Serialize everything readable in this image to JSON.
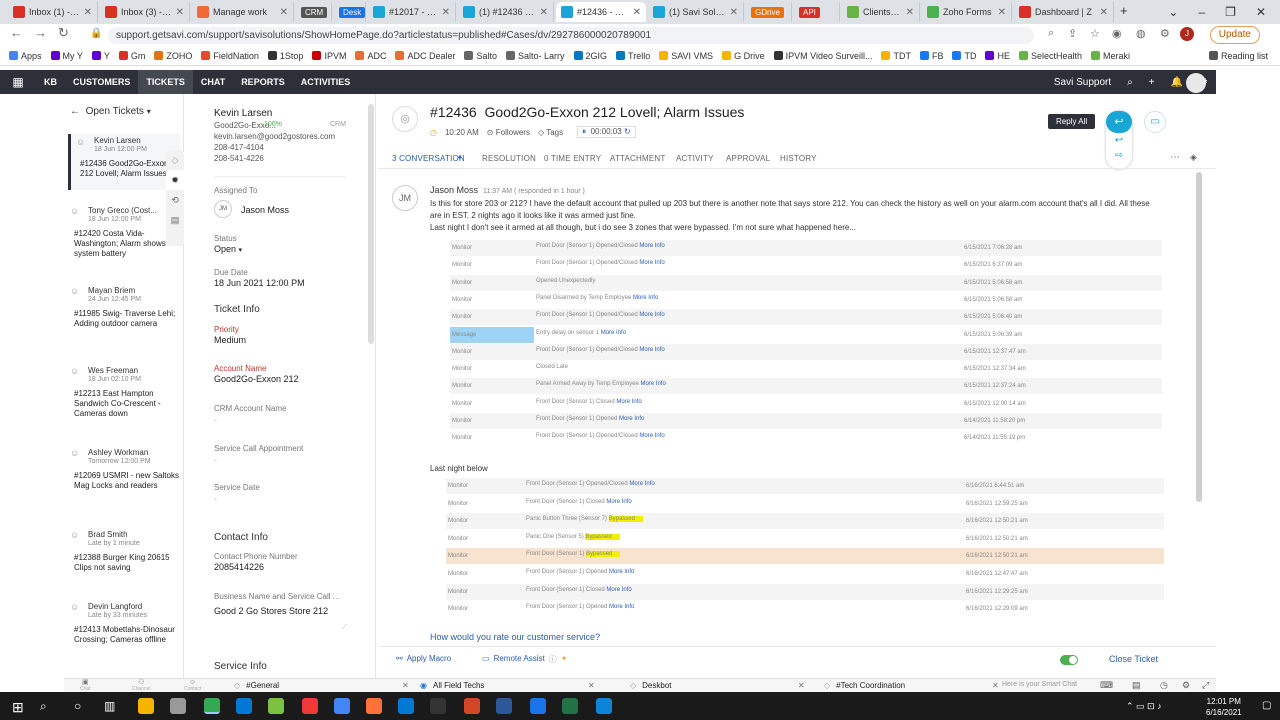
{
  "browser": {
    "tabs": [
      {
        "label": "Inbox (1) - jaso",
        "icon": "gmail-icon",
        "color": "#d93025",
        "chip": ""
      },
      {
        "label": "Inbox (3) - squ",
        "icon": "gmail-icon",
        "color": "#d93025",
        "chip": ""
      },
      {
        "label": "Manage work",
        "icon": "form-icon",
        "color": "#f06a35",
        "chip": ""
      },
      {
        "label": "",
        "icon": "",
        "color": "#555",
        "chip": "CRM"
      },
      {
        "label": "",
        "icon": "",
        "color": "#1a73e8",
        "chip": "Desk"
      },
      {
        "label": "#12017 - Savi",
        "icon": "desk-icon",
        "color": "#19a5d6",
        "chip": ""
      },
      {
        "label": "(1) #12436 - Sa",
        "icon": "desk-icon",
        "color": "#19a5d6",
        "chip": ""
      },
      {
        "label": "#12436 - Savi",
        "icon": "desk-icon",
        "color": "#19a5d6",
        "chip": ""
      },
      {
        "label": "(1) Savi Solutio",
        "icon": "desk-icon",
        "color": "#19a5d6",
        "chip": ""
      },
      {
        "label": "",
        "icon": "",
        "color": "#e8710a",
        "chip": "GDrive"
      },
      {
        "label": "",
        "icon": "",
        "color": "#d93025",
        "chip": "API"
      },
      {
        "label": "Clients - Meraki",
        "icon": "meraki-icon",
        "color": "#67b346",
        "chip": ""
      },
      {
        "label": "Zoho Forms",
        "icon": "form-icon",
        "color": "#4caf50",
        "chip": ""
      },
      {
        "label": "Dashboard | Z",
        "icon": "dashboard-icon",
        "color": "#d93025",
        "chip": ""
      }
    ],
    "url": "support.getsavi.com/support/savisolutions/ShowHomePage.do?articlestatus=published#Cases/dv/292786000020789001",
    "update_label": "Update",
    "bookmarks": [
      {
        "label": "Apps",
        "color": "#4285f4"
      },
      {
        "label": "My Y",
        "color": "#6001d2"
      },
      {
        "label": "Y",
        "color": "#6001d2"
      },
      {
        "label": "Gm",
        "color": "#d93025"
      },
      {
        "label": "ZOHO",
        "color": "#e8710a"
      },
      {
        "label": "FieldNation",
        "color": "#e84a27"
      },
      {
        "label": "1Stop",
        "color": "#333"
      },
      {
        "label": "IPVM",
        "color": "#c00"
      },
      {
        "label": "ADC",
        "color": "#f06a35"
      },
      {
        "label": "ADC Dealer",
        "color": "#f06a35"
      },
      {
        "label": "Salto",
        "color": "#666"
      },
      {
        "label": "Salto- Larry",
        "color": "#666"
      },
      {
        "label": "2GIG",
        "color": "#0077c8"
      },
      {
        "label": "Trello",
        "color": "#0079bf"
      },
      {
        "label": "SAVI VMS",
        "color": "#f4b400"
      },
      {
        "label": "G Drive",
        "color": "#f4b400"
      },
      {
        "label": "IPVM Video Surveill...",
        "color": "#333"
      },
      {
        "label": "TDT",
        "color": "#f4b400"
      },
      {
        "label": "FB",
        "color": "#1877f2"
      },
      {
        "label": "TD",
        "color": "#1877f2"
      },
      {
        "label": "HE",
        "color": "#6001d2"
      },
      {
        "label": "SelectHealth",
        "color": "#67b346"
      },
      {
        "label": "Meraki",
        "color": "#67b346"
      },
      {
        "label": "Reading list",
        "color": "#555"
      }
    ]
  },
  "app_nav": {
    "items": [
      "KB",
      "CUSTOMERS",
      "TICKETS",
      "CHAT",
      "REPORTS",
      "ACTIVITIES"
    ],
    "active": "TICKETS",
    "org": "Savi Support"
  },
  "ticket_list": {
    "header": "Open Tickets",
    "items": [
      {
        "name": "Kevin Larsen",
        "time": "18 Jun 12:00 PM",
        "subject": "#12436 Good2Go-Exxon 212 Lovell; Alarm Issues"
      },
      {
        "name": "Tony Greco (Cost...",
        "time": "18 Jun 12:00 PM",
        "subject": "#12420 Costa Vida-Washington; Alarm shows no system battery"
      },
      {
        "name": "Mayan Briem",
        "time": "24 Jun 12:45 PM",
        "subject": "#11985 Swig- Traverse Lehi; Adding outdoor camera"
      },
      {
        "name": "Wes Freeman",
        "time": "18 Jun 02:10 PM",
        "subject": "#12213 East Hampton Sandwich Co-Crescent - Cameras down"
      },
      {
        "name": "Ashley Workman",
        "time": "Tomorrow 12:00 PM",
        "subject": "#12069 USMRI - new Saltoks Mag Locks and readers"
      },
      {
        "name": "Brad Smith",
        "time": "Late by 1 minute",
        "subject": "#12388 Burger King 20615 Clips not saving"
      },
      {
        "name": "Devin Langford",
        "time": "Late by 33 minutes",
        "subject": "#12413 Mobettahs-Dinosaur Crossing; Cameras offline"
      }
    ]
  },
  "contact": {
    "name": "Kevin Larsen",
    "org": "Good2Go-Exxo...",
    "score": "100%",
    "crm": "CRM",
    "email": "kevin.larsen@good2gostores.com",
    "phone1": "208-417-4104",
    "phone2": "208-541-4226",
    "assigned_label": "Assigned To",
    "assignee_initials": "JM",
    "assignee": "Jason Moss",
    "status_label": "Status",
    "status": "Open",
    "due_label": "Due Date",
    "due": "18 Jun 2021 12:00 PM",
    "ticket_info_heading": "Ticket Info",
    "priority_label": "Priority",
    "priority": "Medium",
    "account_label": "Account Name",
    "account": "Good2Go-Exxon 212",
    "crm_account_label": "CRM Account Name",
    "crm_account": "-",
    "service_call_label": "Service Call Appointment",
    "service_call": "-",
    "service_date_label": "Service Date",
    "service_date": "-",
    "contact_info_heading": "Contact Info",
    "contact_phone_label": "Contact Phone Number",
    "contact_phone": "2085414226",
    "business_label": "Business Name and Service Call Add",
    "business": "Good 2 Go Stores Store 212",
    "service_info_heading": "Service Info"
  },
  "ticket": {
    "number": "#12436",
    "title": "Good2Go-Exxon 212 Lovell; Alarm Issues",
    "time": "10:20 AM",
    "followers_label": "Followers",
    "tags_label": "Tags",
    "timer": "00:00:03",
    "reply_all_label": "Reply All",
    "tabs": [
      "3 CONVERSATION",
      "RESOLUTION",
      "0 TIME ENTRY",
      "ATTACHMENT",
      "ACTIVITY",
      "APPROVAL",
      "HISTORY"
    ],
    "author": "Jason Moss",
    "author_initials": "JM",
    "author_time": "11:37 AM ( responded in 1 hour )",
    "body_lines": [
      "Is this for store 203 or 212?  I have the default account that pulled up 203 but there is another note that says store 212. You can check the history as well on your alarm.com account that's all I did. All these are in EST. 2 nights ago it looks like it was armed just fine.",
      "Last night I don't see it armed at all though, but i do see 3 zones that were bypassed.  I'm not sure what happened here..."
    ],
    "log1": [
      {
        "type": "Monitor",
        "event": "Front Door (Sensor 1) Opened/Closed",
        "more": "More Info",
        "date": "6/15/2021 7:06:28 am"
      },
      {
        "type": "Monitor",
        "event": "Front Door (Sensor 1) Opened/Closed",
        "more": "More Info",
        "date": "6/15/2021 6:37:09 am"
      },
      {
        "type": "Monitor",
        "event": "Opened Unexpectedly",
        "more": "",
        "date": "6/15/2021 5:06:58 am"
      },
      {
        "type": "Monitor",
        "event": "Panel Disarmed by Temp Employee",
        "more": "More Info",
        "date": "6/15/2021 5:06:58 am"
      },
      {
        "type": "Monitor",
        "event": "Front Door (Sensor 1) Opened/Closed",
        "more": "More Info",
        "date": "6/15/2021 5:06:40 am"
      },
      {
        "type": "Message",
        "event": "Entry delay on sensor 1",
        "more": "More Info",
        "date": "6/15/2021 5:06:39 am"
      },
      {
        "type": "Monitor",
        "event": "Front Door (Sensor 1) Opened/Closed",
        "more": "More Info",
        "date": "6/15/2021 12:37:47 am"
      },
      {
        "type": "Monitor",
        "event": "Closed Late",
        "more": "",
        "date": "6/15/2021 12:37:34 am"
      },
      {
        "type": "Monitor",
        "event": "Panel Armed Away by Temp Employee",
        "more": "More Info",
        "date": "6/15/2021 12:37:24 am"
      },
      {
        "type": "Monitor",
        "event": "Front Door (Sensor 1) Closed",
        "more": "More Info",
        "date": "6/15/2021 12:00:14 am"
      },
      {
        "type": "Monitor",
        "event": "Front Door (Sensor 1) Opened",
        "more": "More Info",
        "date": "6/14/2021 11:58:20 pm"
      },
      {
        "type": "Monitor",
        "event": "Front Door (Sensor 1) Opened/Closed",
        "more": "More Info",
        "date": "6/14/2021 11:55:19 pm"
      }
    ],
    "last_night_label": "Last night below",
    "log2": [
      {
        "type": "Monitor",
        "event": "Front Door (Sensor 1) Opened/Closed",
        "more": "More Info",
        "bypassed": "",
        "date": "6/16/2021 6:44:51 am"
      },
      {
        "type": "Monitor",
        "event": "Front Door (Sensor 1) Closed",
        "more": "More Info",
        "bypassed": "",
        "date": "6/16/2021 12:59:25 am"
      },
      {
        "type": "Monitor",
        "event": "Panic Button Three (Sensor 7)",
        "more": "",
        "bypassed": "Bypassed",
        "date": "6/16/2021 12:50:21 am"
      },
      {
        "type": "Monitor",
        "event": "Panic One (Sensor 5)",
        "more": "",
        "bypassed": "Bypassed",
        "date": "6/16/2021 12:50:21 am"
      },
      {
        "type": "Monitor",
        "event": "Front Door (Sensor 1)",
        "more": "",
        "bypassed": "Bypassed",
        "date": "6/16/2021 12:50:21 am"
      },
      {
        "type": "Monitor",
        "event": "Front Door (Sensor 1) Opened",
        "more": "More Info",
        "bypassed": "",
        "date": "6/16/2021 12:47:47 am"
      },
      {
        "type": "Monitor",
        "event": "Front Door (Sensor 1) Closed",
        "more": "More Info",
        "bypassed": "",
        "date": "6/16/2021 12:29:25 am"
      },
      {
        "type": "Monitor",
        "event": "Front Door (Sensor 1) Opened",
        "more": "More Info",
        "bypassed": "",
        "date": "6/16/2021 12:29:09 am"
      }
    ],
    "rating_question": "How would you rate our customer service?",
    "apply_macro_label": "Apply Macro",
    "remote_assist_label": "Remote Assist",
    "close_ticket_label": "Close Ticket"
  },
  "chat_bar": {
    "items": [
      "Chat",
      "Channel",
      "Contact"
    ],
    "channels": [
      "#General",
      "All Field Techs",
      "Deskbot",
      "#Tech Coordination"
    ],
    "smart_chat_placeholder": "Here is your Smart Chat"
  },
  "taskbar": {
    "time": "12:01 PM",
    "date": "6/16/2021"
  },
  "colors": {
    "nav_bg": "#2d3038",
    "accent": "#1a73e8",
    "reply_all": "#19a5d6",
    "message_row": "#9fd3f5",
    "bypass_row": "#f8e2d0",
    "bypassed_highlight": "#f0f000"
  }
}
